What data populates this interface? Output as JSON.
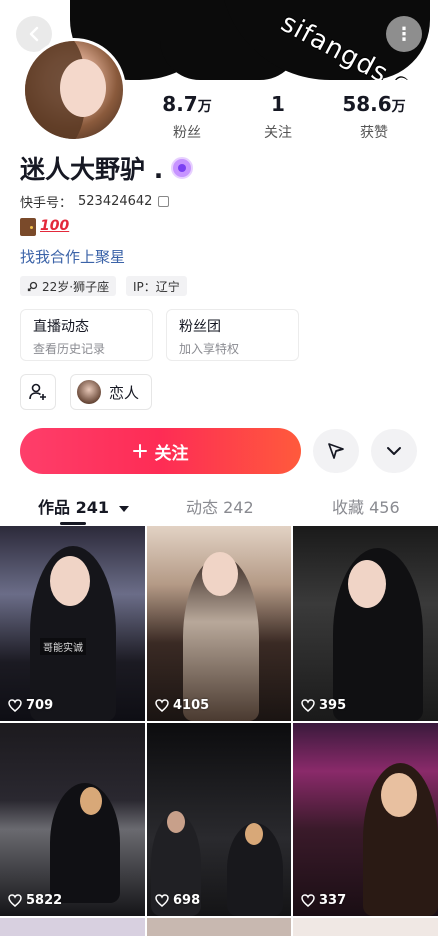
{
  "watermark": "sifangds.com",
  "stats": [
    {
      "value": "8.7",
      "unit": "万",
      "label": "粉丝"
    },
    {
      "value": "1",
      "unit": "",
      "label": "关注"
    },
    {
      "value": "58.6",
      "unit": "万",
      "label": "获赞"
    }
  ],
  "profile": {
    "name": "迷人大野驴 .",
    "uid_label": "快手号：",
    "uid": "523424642",
    "link": "找我合作上聚星",
    "tag_age": "22岁·狮子座",
    "tag_ip": "IP：辽宁"
  },
  "cards": [
    {
      "title": "直播动态",
      "sub": "查看历史记录"
    },
    {
      "title": "粉丝团",
      "sub": "加入享特权"
    }
  ],
  "relation_label": "恋人",
  "follow_label": "关注",
  "tabs": [
    {
      "label": "作品 241",
      "active": true
    },
    {
      "label": "动态 242",
      "active": false
    },
    {
      "label": "收藏 456",
      "active": false
    }
  ],
  "videos": [
    {
      "likes": "709",
      "overlay": "哥能实诚"
    },
    {
      "likes": "4105"
    },
    {
      "likes": "395"
    },
    {
      "likes": "5822"
    },
    {
      "likes": "698"
    },
    {
      "likes": "337"
    }
  ],
  "colors": {
    "accent": "#fe2c55",
    "link": "#3b63a8"
  }
}
